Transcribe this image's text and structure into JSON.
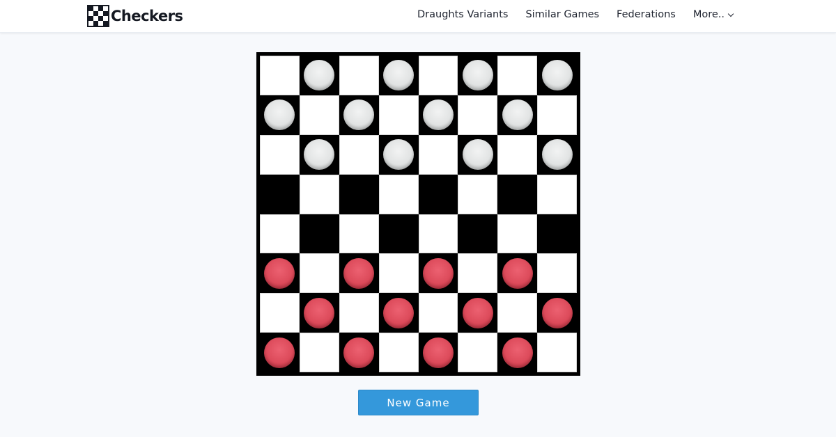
{
  "brand": {
    "name": "Checkers",
    "logo_icon": "checkerboard-icon"
  },
  "nav": {
    "items": [
      {
        "label": "Draughts Variants"
      },
      {
        "label": "Similar Games"
      },
      {
        "label": "Federations"
      },
      {
        "label": "More.."
      }
    ],
    "more_icon": "chevron-down-icon"
  },
  "board": {
    "size": 8,
    "light_color": "#ffffff",
    "dark_color": "#000000",
    "pieces_by_row": [
      [
        "",
        "w",
        "",
        "w",
        "",
        "w",
        "",
        "w"
      ],
      [
        "w",
        "",
        "w",
        "",
        "w",
        "",
        "w",
        ""
      ],
      [
        "",
        "w",
        "",
        "w",
        "",
        "w",
        "",
        "w"
      ],
      [
        "",
        "",
        "",
        "",
        "",
        "",
        "",
        ""
      ],
      [
        "",
        "",
        "",
        "",
        "",
        "",
        "",
        ""
      ],
      [
        "r",
        "",
        "r",
        "",
        "r",
        "",
        "r",
        ""
      ],
      [
        "",
        "r",
        "",
        "r",
        "",
        "r",
        "",
        "r"
      ],
      [
        "r",
        "",
        "r",
        "",
        "r",
        "",
        "r",
        ""
      ]
    ],
    "piece_colors": {
      "w": "#e1e3e3",
      "r": "#dc4a5a"
    }
  },
  "actions": {
    "new_game_label": "New Game",
    "new_game_color": "#3498db"
  }
}
